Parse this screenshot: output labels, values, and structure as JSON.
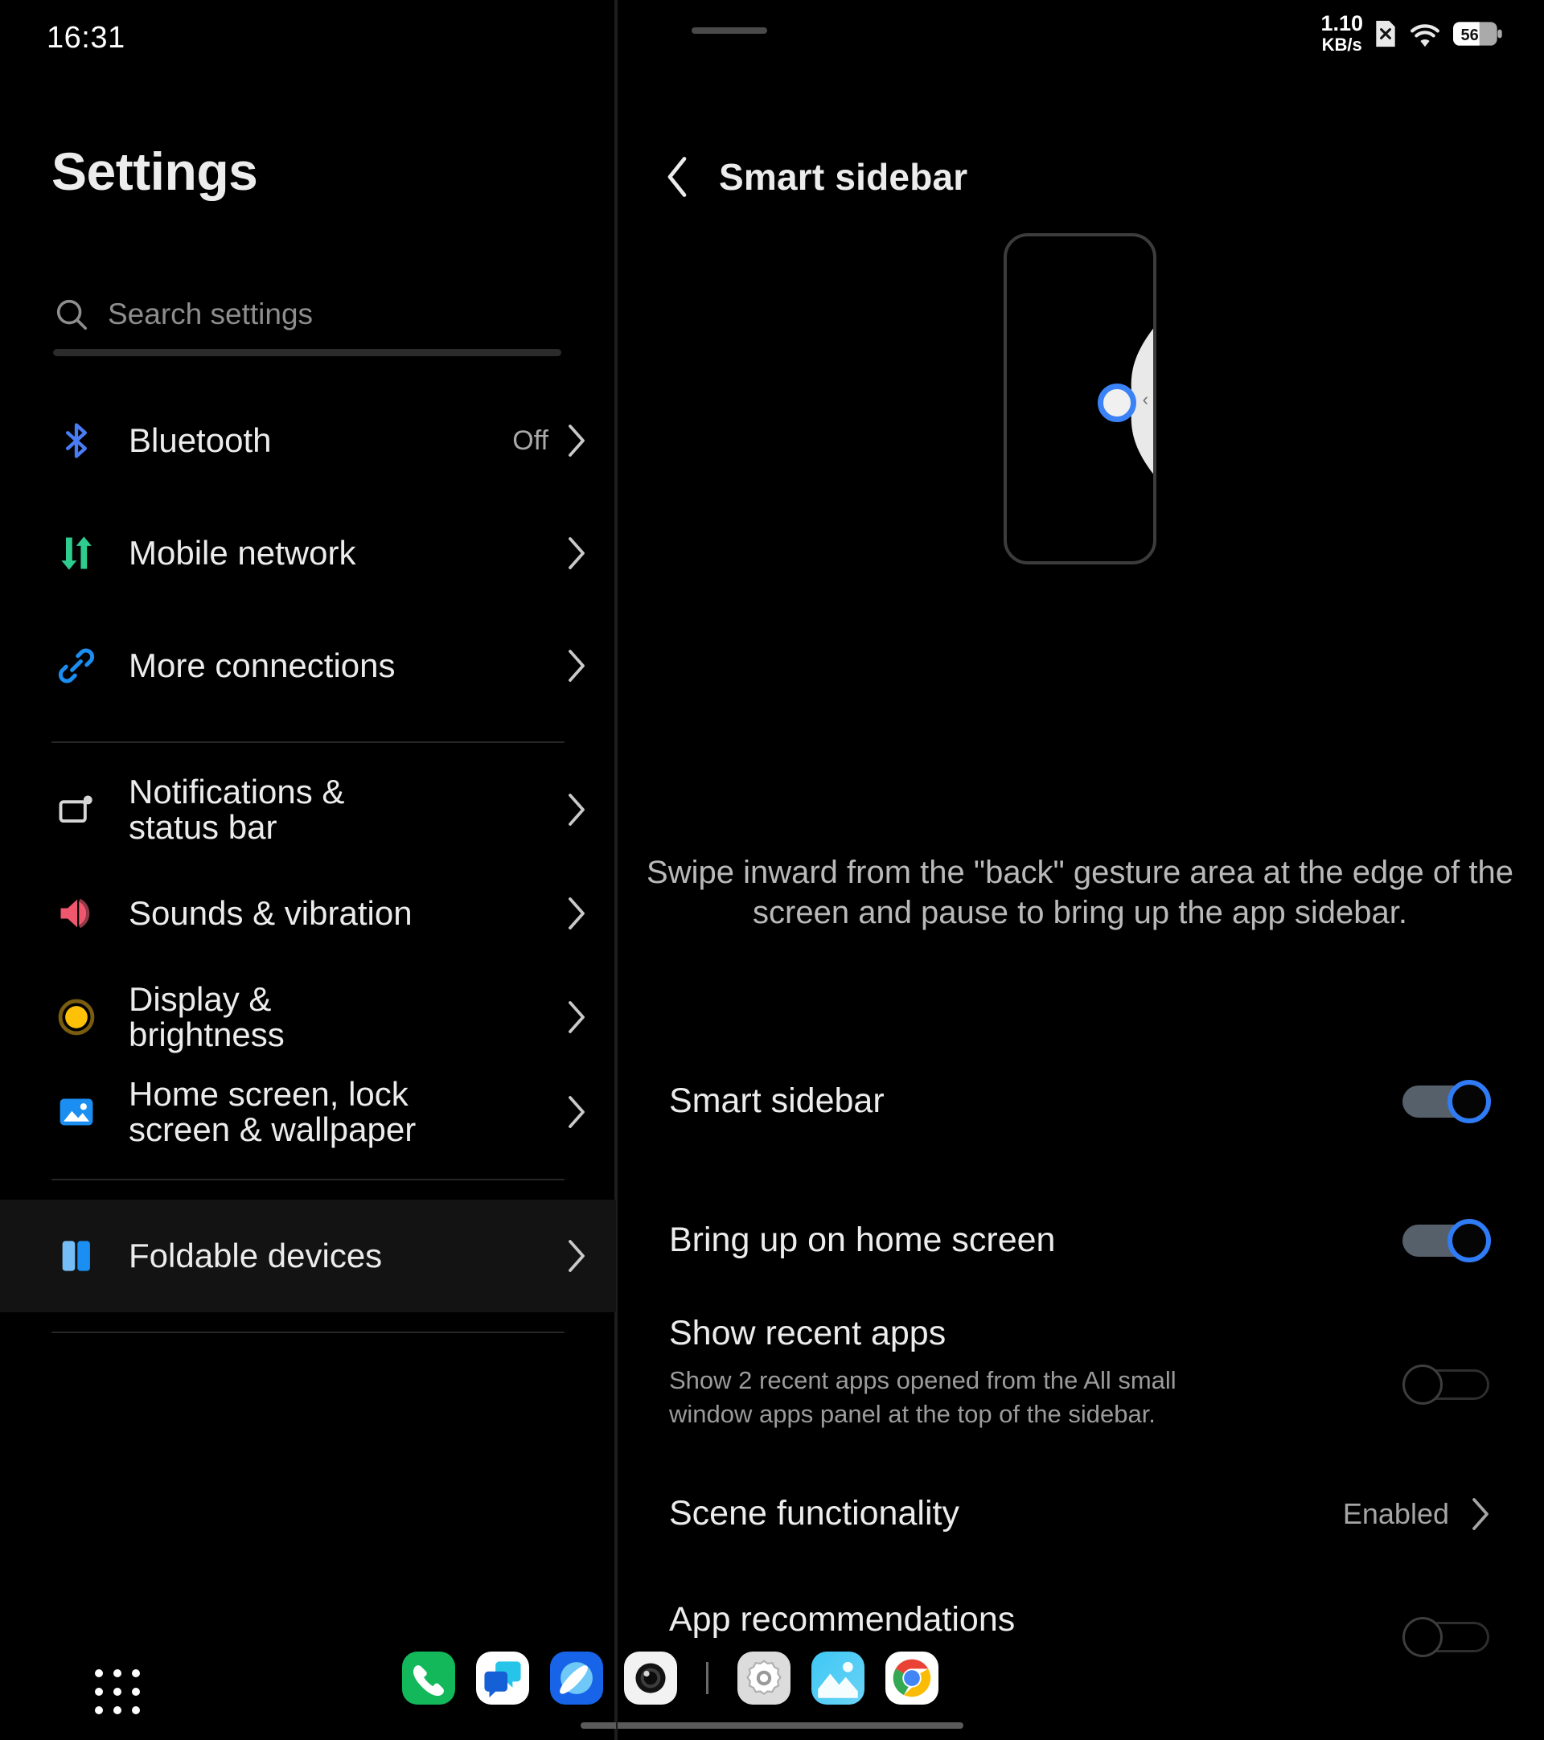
{
  "status_bar": {
    "time": "16:31",
    "net_speed_value": "1.10",
    "net_speed_unit": "KB/s",
    "sim_icon": "sim-card-off-icon",
    "wifi_icon": "wifi-icon",
    "battery_level": "56"
  },
  "sidebar": {
    "title": "Settings",
    "search": {
      "placeholder": "Search settings",
      "value": "",
      "icon": "search-icon"
    },
    "groups": [
      {
        "items": [
          {
            "label": "Bluetooth",
            "value": "Off",
            "icon": "bluetooth-icon",
            "color": "#4a7cf5"
          },
          {
            "label": "Mobile network",
            "value": "",
            "icon": "mobile-network-icon",
            "color": "#2ecc8f"
          },
          {
            "label": "More connections",
            "value": "",
            "icon": "link-icon",
            "color": "#1b8ef2"
          }
        ]
      },
      {
        "items": [
          {
            "label": "Notifications &\nstatus bar",
            "value": "",
            "icon": "notifications-icon",
            "color": "#d6d6d6"
          },
          {
            "label": "Sounds & vibration",
            "value": "",
            "icon": "sound-icon",
            "color": "#f0566e"
          },
          {
            "label": "Display &\nbrightness",
            "value": "",
            "icon": "display-brightness-icon",
            "color": "#ffc107"
          },
          {
            "label": "Home screen, lock\nscreen & wallpaper",
            "value": "",
            "icon": "wallpaper-icon",
            "color": "#1b8ef2"
          }
        ]
      },
      {
        "items": [
          {
            "label": "Foldable devices",
            "value": "",
            "icon": "foldable-devices-icon",
            "color": "#2196f3",
            "selected": true
          }
        ]
      }
    ]
  },
  "detail": {
    "back_icon": "back-chevron-icon",
    "title": "Smart sidebar",
    "illustration": {
      "name": "phone-edge-swipe-illustration",
      "touch_point_icon": "touch-point-icon",
      "edge_chevron_icon": "chevron-left-icon"
    },
    "description": "Swipe inward from the \"back\" gesture area at the edge of the screen and pause to bring up the app sidebar.",
    "rows": [
      {
        "title": "Smart sidebar",
        "subtitle": "",
        "control": "toggle",
        "state": "on"
      },
      {
        "title": "Bring up on home screen",
        "subtitle": "",
        "control": "toggle",
        "state": "on"
      },
      {
        "title": "Show recent apps",
        "subtitle": "Show 2 recent apps opened from the All small window apps panel at the top of the sidebar.",
        "control": "toggle",
        "state": "off"
      },
      {
        "title": "Scene functionality",
        "subtitle": "",
        "control": "link",
        "value": "Enabled"
      },
      {
        "title": "App recommendations",
        "subtitle": "",
        "control": "toggle",
        "state": "off"
      }
    ]
  },
  "dock": {
    "app_drawer_icon": "app-drawer-icon",
    "apps": [
      {
        "name": "phone-app-icon"
      },
      {
        "name": "messages-app-icon"
      },
      {
        "name": "browser-app-icon"
      },
      {
        "name": "camera-app-icon"
      },
      {
        "name": "separator"
      },
      {
        "name": "settings-app-icon"
      },
      {
        "name": "gallery-app-icon"
      },
      {
        "name": "chrome-app-icon"
      }
    ],
    "gesture_bar_icon": "gesture-bar"
  },
  "colors": {
    "accent_blue": "#2f7cf6",
    "bg": "#000000",
    "text_primary": "#ececec",
    "text_secondary": "#9b9b9b"
  }
}
